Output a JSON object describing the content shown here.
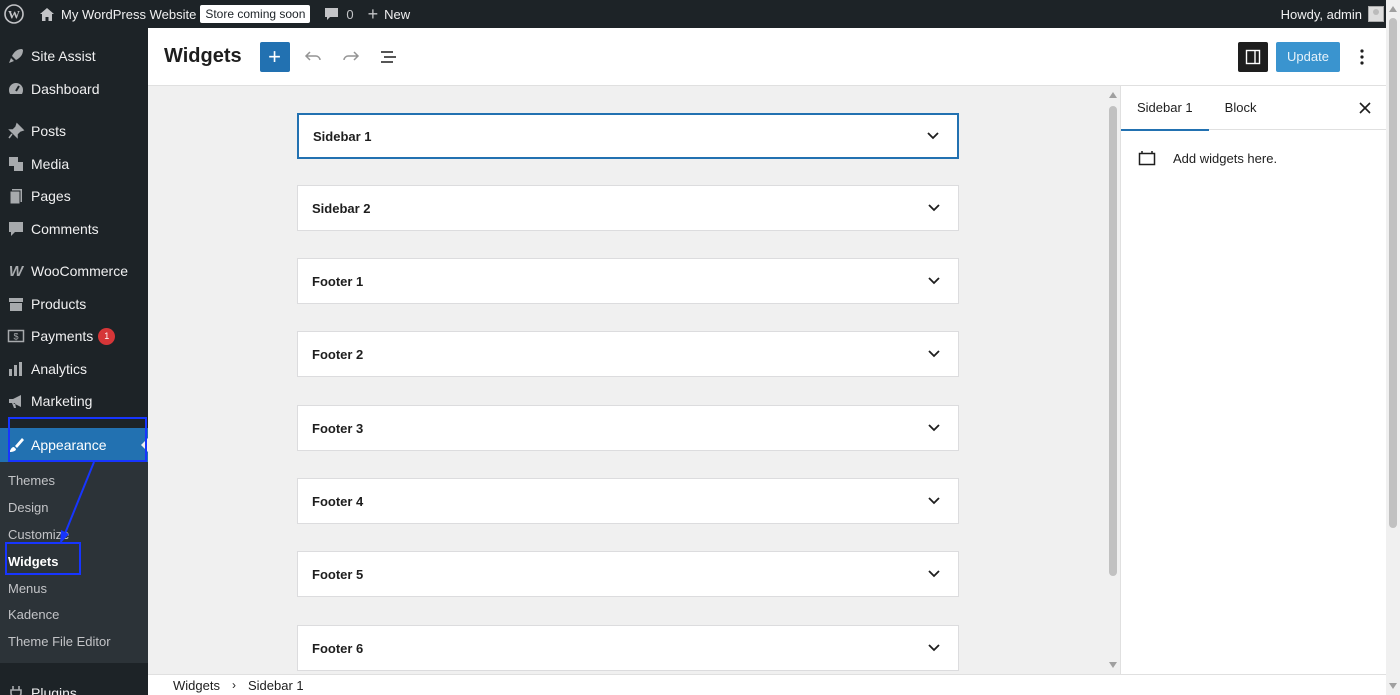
{
  "admin_bar": {
    "site_name": "My WordPress Website",
    "store_badge": "Store coming soon",
    "comments_count": "0",
    "new_label": "New",
    "howdy": "Howdy, admin"
  },
  "sidebar": {
    "items": [
      {
        "label": "Site Assist",
        "icon": "rocket-icon"
      },
      {
        "label": "Dashboard",
        "icon": "dashboard-icon"
      },
      {
        "label": "Posts",
        "icon": "pin-icon"
      },
      {
        "label": "Media",
        "icon": "media-icon"
      },
      {
        "label": "Pages",
        "icon": "pages-icon"
      },
      {
        "label": "Comments",
        "icon": "comment-icon"
      },
      {
        "label": "WooCommerce",
        "icon": "woo-icon"
      },
      {
        "label": "Products",
        "icon": "archive-icon"
      },
      {
        "label": "Payments",
        "icon": "payments-icon",
        "badge": "1"
      },
      {
        "label": "Analytics",
        "icon": "chart-icon"
      },
      {
        "label": "Marketing",
        "icon": "megaphone-icon"
      },
      {
        "label": "Appearance",
        "icon": "brush-icon"
      }
    ],
    "submenu": [
      "Themes",
      "Design",
      "Customize",
      "Widgets",
      "Menus",
      "Kadence",
      "Theme File Editor"
    ],
    "next_item": "Plugins"
  },
  "editor": {
    "title": "Widgets",
    "update_label": "Update"
  },
  "widget_areas": [
    "Sidebar 1",
    "Sidebar 2",
    "Footer 1",
    "Footer 2",
    "Footer 3",
    "Footer 4",
    "Footer 5",
    "Footer 6"
  ],
  "settings_panel": {
    "tab_area": "Sidebar 1",
    "tab_block": "Block",
    "message": "Add widgets here."
  },
  "breadcrumb": {
    "root": "Widgets",
    "current": "Sidebar 1"
  },
  "colors": {
    "admin_dark": "#1d2327",
    "accent": "#2271b1",
    "highlight": "#1735ff"
  }
}
